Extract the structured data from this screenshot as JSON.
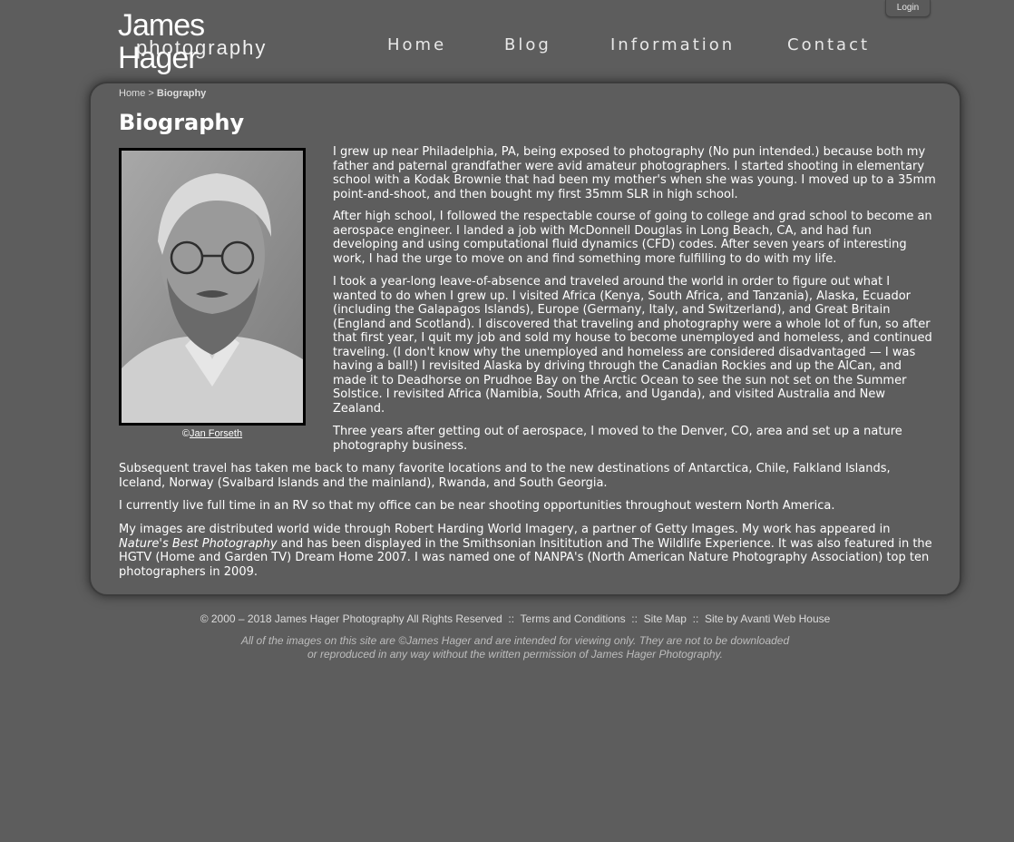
{
  "header": {
    "logo_top": "James Hager",
    "logo_bottom": "photography",
    "login": "Login",
    "nav": [
      "Home",
      "Blog",
      "Information",
      "Contact"
    ]
  },
  "breadcrumb": {
    "home": "Home",
    "separator": " > ",
    "current": "Biography"
  },
  "page_title": "Biography",
  "photo": {
    "alt": "Portrait of James Hager",
    "credit_prefix": "©",
    "credit_name": "Jan Forseth"
  },
  "paragraphs": {
    "p1": "I grew up near Philadelphia, PA, being exposed to photography (No pun intended.) because both my father and paternal grandfather were avid amateur photographers. I started shooting in elementary school with a Kodak Brownie that had been my mother's when she was young. I moved up to a 35mm point-and-shoot, and then bought my first 35mm SLR in high school.",
    "p2": "After high school, I followed the respectable course of going to college and grad school to become an aerospace engineer. I landed a job with McDonnell Douglas in Long Beach, CA, and had fun developing and using computational fluid dynamics (CFD) codes. After seven years of interesting work, I had the urge to move on and find something more fulfilling to do with my life.",
    "p3": "I took a year-long leave-of-absence and traveled around the world in order to figure out what I wanted to do when I grew up. I visited Africa (Kenya, South Africa, and Tanzania), Alaska, Ecuador (including the Galapagos Islands), Europe (Germany, Italy, and Switzerland), and Great Britain (England and Scotland). I discovered that traveling and photography were a whole lot of fun, so after that first year, I quit my job and sold my house to become unemployed and homeless, and continued traveling. (I don't know why the unemployed and homeless are considered disadvantaged — I was having a ball!) I revisited Alaska by driving through the Canadian Rockies and up the AlCan, and made it to Deadhorse on Prudhoe Bay on the Arctic Ocean to see the sun not set on the Summer Solstice. I revisited Africa (Namibia, South Africa, and Uganda), and visited Australia and New Zealand.",
    "p4": "Three years after getting out of aerospace, I moved to the Denver, CO, area and set up a nature photography business.",
    "p5": "Subsequent travel has taken me back to many favorite locations and to the new destinations of Antarctica, Chile, Falkland Islands, Iceland, Norway (Svalbard Islands and the mainland), Rwanda, and South Georgia.",
    "p6": "I currently live full time in an RV so that my office can be near shooting opportunities throughout western North America.",
    "p7_a": "My images are distributed world wide through Robert Harding World Imagery, a partner of Getty Images. My work has appeared in ",
    "p7_em": "Nature's Best Photography",
    "p7_b": " and has been displayed in the Smithsonian Insititution and The Wildlife Experience. It was also featured in the HGTV (Home and Garden TV) Dream Home 2007. I was named one of NANPA's (North American Nature Photography Association) top ten photographers in 2009."
  },
  "footer": {
    "copyright": "© 2000 – 2018 James Hager Photography All Rights Reserved",
    "sep": "  ::  ",
    "terms": "Terms and Conditions",
    "sitemap": "Site Map",
    "credit": "Site by Avanti Web House",
    "note": "All of the images on this site are ©James Hager and are intended for viewing only. They are not to be downloaded or reproduced in any way without the written permission of James Hager Photography."
  }
}
